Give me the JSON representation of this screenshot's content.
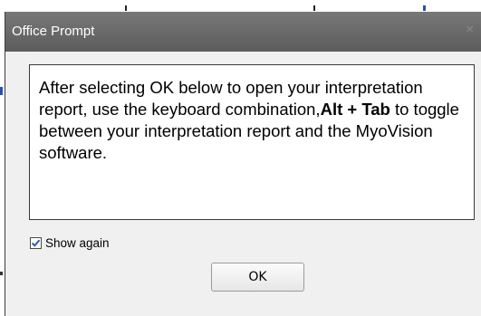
{
  "dialog": {
    "title": "Office Prompt",
    "close_glyph": "×",
    "message_before": "After selecting OK below to open your interpretation report, use the keyboard combination,",
    "message_shortcut": "Alt + Tab",
    "message_after": " to toggle between your interpretation report and the MyoVision software.",
    "checkbox": {
      "label": "Show again",
      "checked": true
    },
    "ok_button_label": "OK"
  },
  "colors": {
    "titlebar": "#666666",
    "dialog_bg": "#f0f0f0",
    "text_box_bg": "#ffffff",
    "checkmark": "#2d5fb3"
  },
  "icons": {
    "close": "close-icon",
    "checkbox": "checkmark-icon"
  }
}
